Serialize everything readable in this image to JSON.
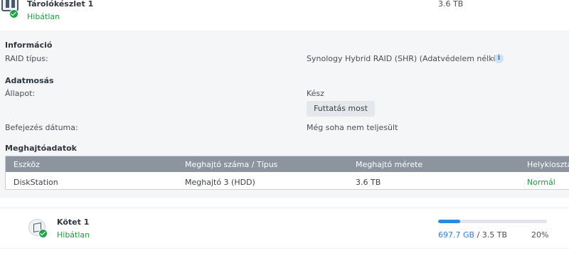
{
  "pool": {
    "title": "Tárolókészlet 1",
    "status": "Hibátlan",
    "size": "3.6 TB"
  },
  "info": {
    "section_title": "Információ",
    "raid_label": "RAID típus:",
    "raid_value": "Synology Hybrid RAID (SHR) (Adatvédelem nélkül)",
    "info_icon": "i"
  },
  "scrub": {
    "section_title": "Adatmosás",
    "state_label": "Állapot:",
    "state_value": "Kész",
    "run_button": "Futtatás most",
    "completed_label": "Befejezés dátuma:",
    "completed_value": "Még soha nem teljesült"
  },
  "drives": {
    "section_title": "Meghajtóadatok",
    "columns": [
      "Eszköz",
      "Meghajtó száma / Típus",
      "Meghajtó mérete",
      "Helykiosztás"
    ],
    "rows": [
      {
        "device": "DiskStation",
        "drive": "Meghajtó 3 (HDD)",
        "size": "3.6 TB",
        "allocation": "Normál"
      }
    ]
  },
  "volume": {
    "title": "Kötet 1",
    "status": "Hibátlan",
    "used": "697.7 GB",
    "separator": " / ",
    "total": "3.5 TB",
    "percent_text": "20%",
    "usage_fraction": 0.2
  },
  "colors": {
    "healthy": "#1f9a3c",
    "accent": "#2a8ae0"
  },
  "icons": {
    "pool": "storage-pool-icon",
    "volume": "volume-cube-icon",
    "healthy": "check-circle-icon",
    "info": "info-icon"
  }
}
